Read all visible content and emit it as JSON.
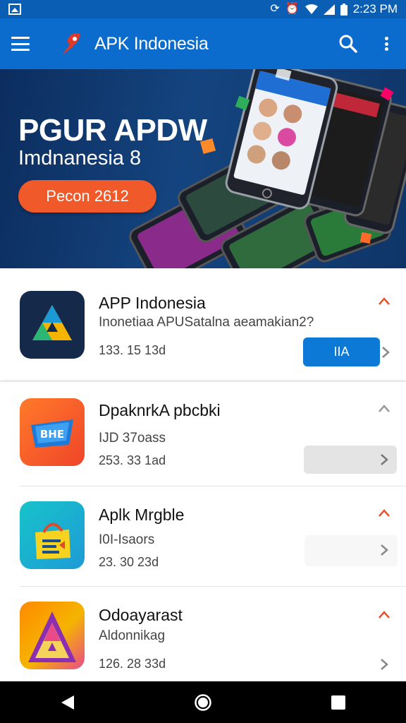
{
  "status_bar": {
    "time": "2:23 PM"
  },
  "app_bar": {
    "title": "APK Indonesia"
  },
  "banner": {
    "title": "PGUR APDW",
    "subtitle": "Imdnanesia 8",
    "button_label": "Pecon 2612"
  },
  "list": [
    {
      "title": "APP Indonesia",
      "subtitle": "Inonetiaa APUSatalna aeamakian2?",
      "meta": "133. 15 13d",
      "action_label": "IIA"
    },
    {
      "title": "DpaknrkA pbcbki",
      "subtitle": "IJD 37oass",
      "meta": "253. 33 1ad"
    },
    {
      "title": "Aplk Mrgble",
      "subtitle": "I0I-Isaors",
      "meta": "23. 30 23d"
    },
    {
      "title": "Odoayarast",
      "subtitle": "Aldonnikag",
      "meta": "126. 28 33d"
    }
  ],
  "colors": {
    "app_bar": "#0b6ccd",
    "accent_button": "#0c79d6",
    "banner_button": "#f0592a",
    "chevron_accent": "#e2542f"
  }
}
